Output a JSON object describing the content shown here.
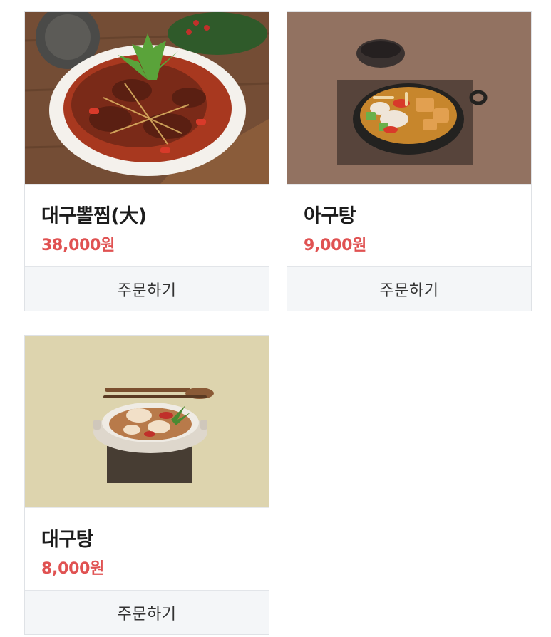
{
  "menu": {
    "items": [
      {
        "name": "대구뽈찜(大)",
        "price": "38,000원",
        "order_label": "주문하기",
        "photo": "braised-cod-cheek-photo"
      },
      {
        "name": "아구탕",
        "price": "9,000원",
        "order_label": "주문하기",
        "photo": "monkfish-stew-photo"
      },
      {
        "name": "대구탕",
        "price": "8,000원",
        "order_label": "주문하기",
        "photo": "cod-soup-photo"
      }
    ]
  },
  "colors": {
    "price": "#e05252",
    "button_bg": "#f4f6f8",
    "border": "#dfe2e6"
  }
}
